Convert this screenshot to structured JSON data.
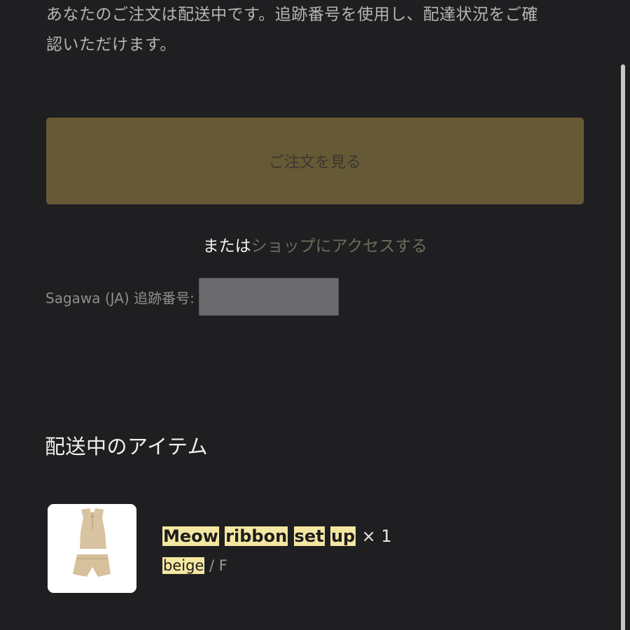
{
  "intro": {
    "line1": "あなたのご注文は配送中です。追跡番号を使用し、配達状況をご確",
    "line2": "認いただけます。"
  },
  "primary_button": {
    "label": "ご注文を見る"
  },
  "alternative": {
    "prefix": "または",
    "link": "ショップにアクセスする"
  },
  "tracking": {
    "label": "Sagawa (JA) 追跡番号:",
    "value": ""
  },
  "items_section": {
    "title": "配送中のアイテム",
    "items": [
      {
        "name_words": [
          "Meow",
          "ribbon",
          "set",
          "up"
        ],
        "quantity": "× 1",
        "color": "beige",
        "size": "/ F",
        "image_icon": "beige-knit-setup-product-image"
      }
    ]
  },
  "colors": {
    "background": "#1f1f21",
    "button": "#665935",
    "highlight": "#f4e7a1"
  }
}
